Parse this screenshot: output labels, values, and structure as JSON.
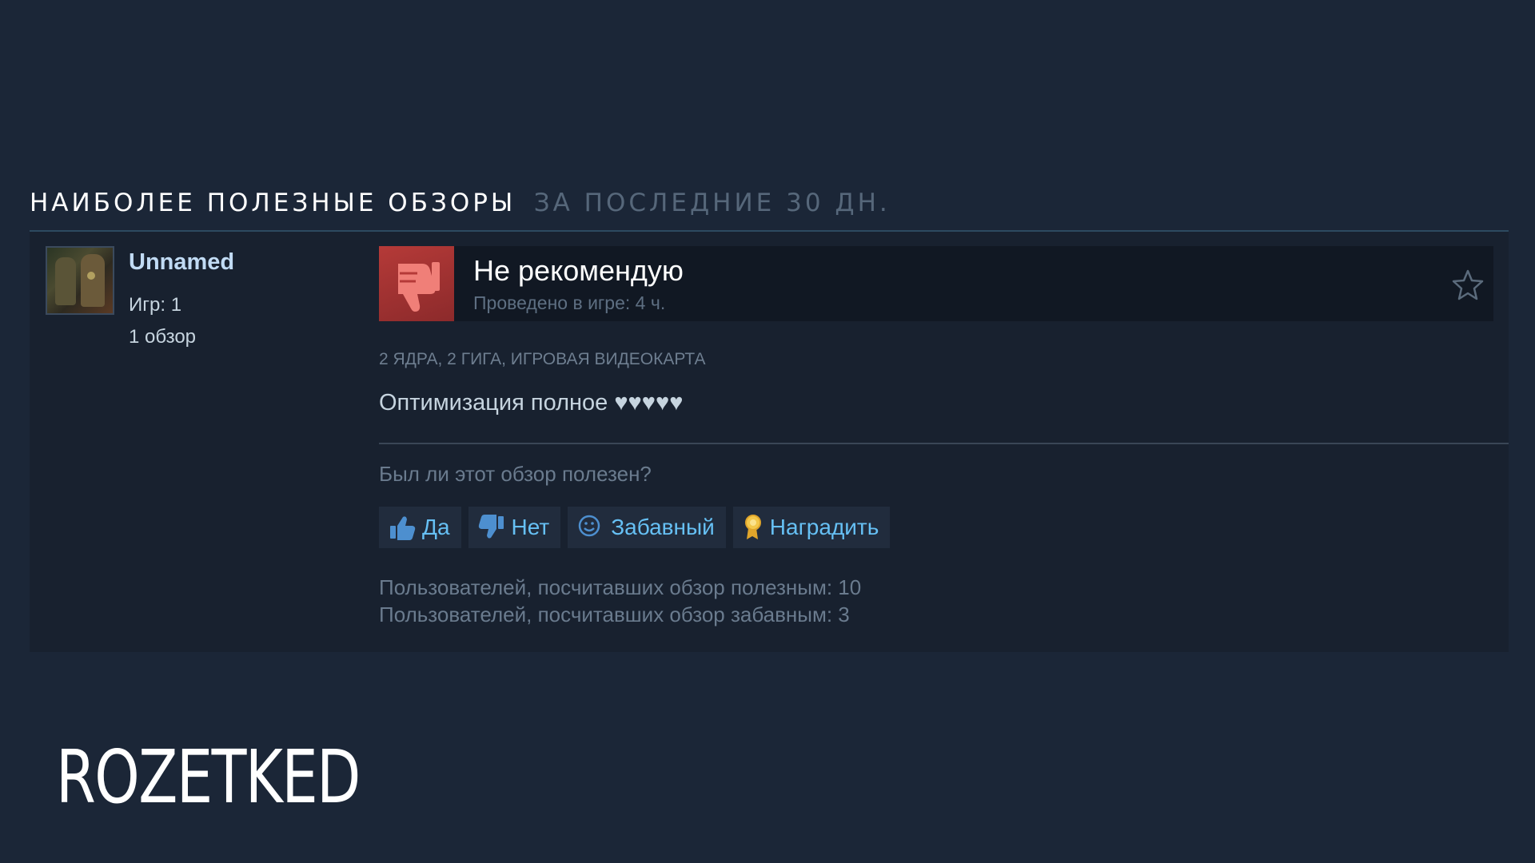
{
  "section": {
    "title_main": "НАИБОЛЕЕ ПОЛЕЗНЫЕ ОБЗОРЫ",
    "title_sub": "ЗА ПОСЛЕДНИЕ 30 ДН."
  },
  "reviewer": {
    "name": "Unnamed",
    "games": "Игр: 1",
    "reviews": "1 обзор"
  },
  "review": {
    "verdict": "Не рекомендую",
    "playtime": "Проведено в игре: 4 ч.",
    "hardware_line": "2 ЯДРА, 2 ГИГА, ИГРОВАЯ ВИДЕОКАРТА",
    "text": "Оптимизация полное ♥♥♥♥♥"
  },
  "helpful": {
    "question": "Был ли этот обзор полезен?",
    "yes_label": "Да",
    "no_label": "Нет",
    "funny_label": "Забавный",
    "award_label": "Наградить"
  },
  "stats": {
    "helpful_line": "Пользователей, посчитавших обзор полезным: 10",
    "funny_line": "Пользователей, посчитавших обзор забавным: 3"
  },
  "logo": "ROZETKED",
  "colors": {
    "background": "#1b2637",
    "card": "#18212f",
    "link": "#66c0f4",
    "thumb_down": "#b53a38"
  },
  "icons": [
    "thumbs-down-icon",
    "star-icon",
    "thumbs-up-icon",
    "smiley-icon",
    "award-icon"
  ]
}
